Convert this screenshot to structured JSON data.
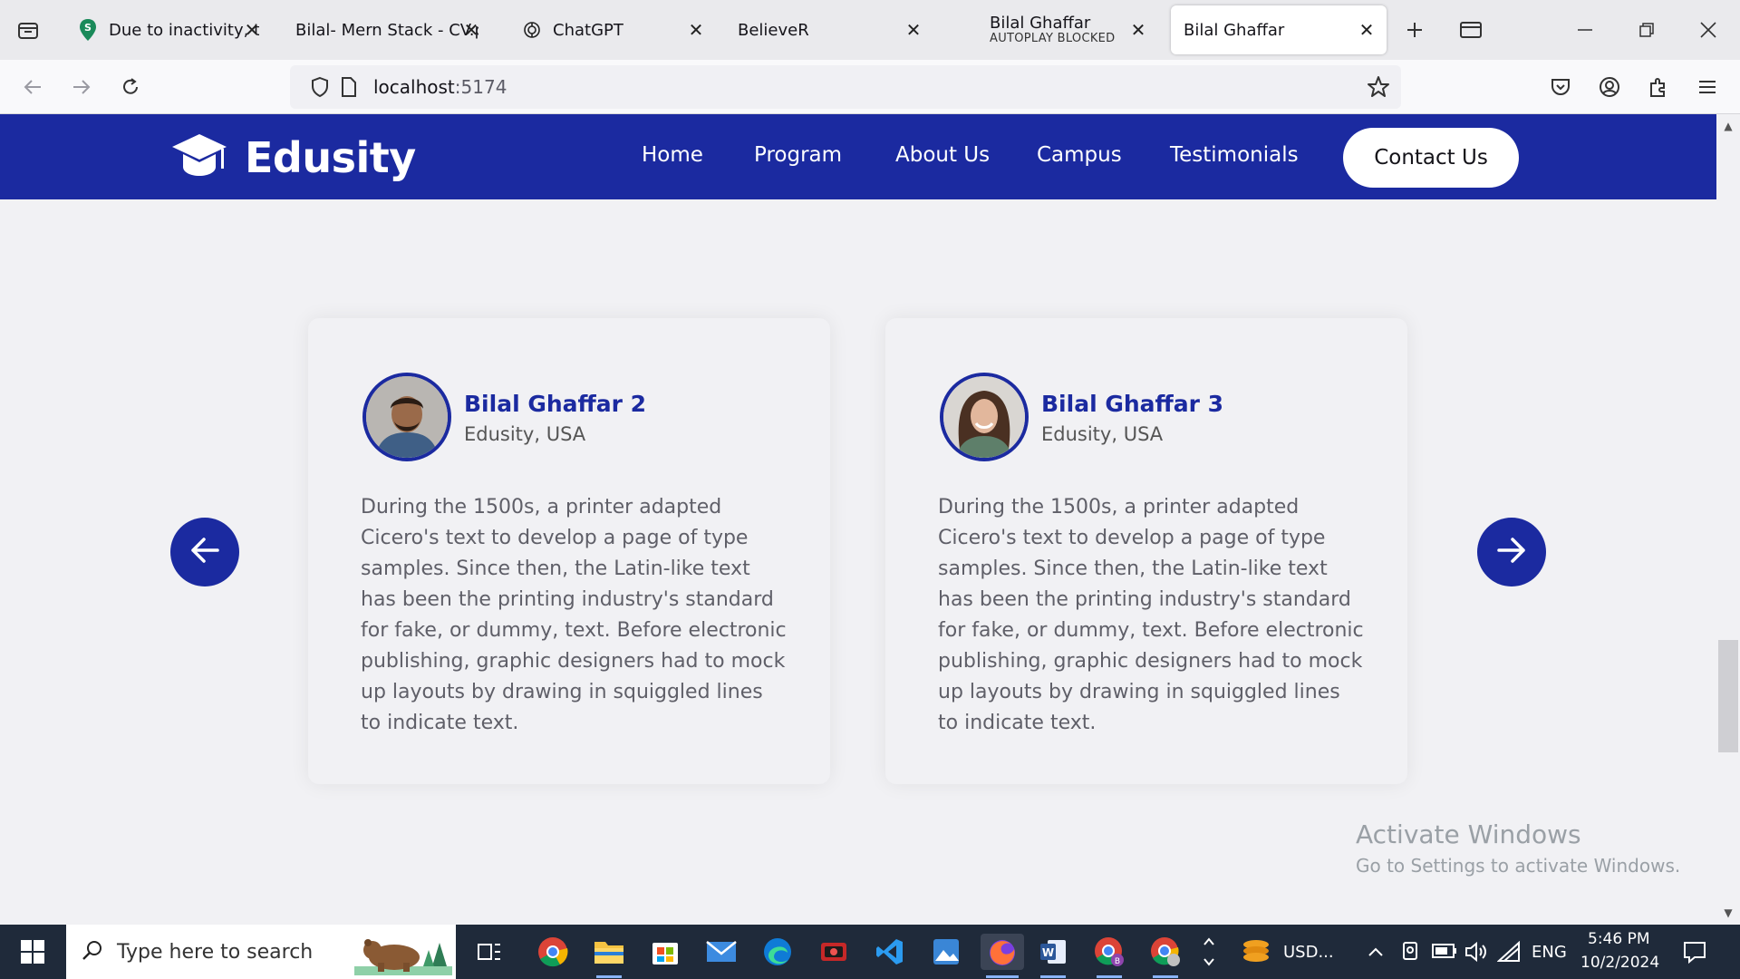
{
  "browser": {
    "tabs": [
      {
        "title": "Due to inactivity, the",
        "subtitle": "",
        "icon": "green-s-icon"
      },
      {
        "title": "Bilal- Mern Stack - CV.p",
        "subtitle": "",
        "icon": "none"
      },
      {
        "title": "ChatGPT",
        "subtitle": "",
        "icon": "chatgpt-icon"
      },
      {
        "title": "BelieveR",
        "subtitle": "",
        "icon": "none"
      },
      {
        "title": "Bilal Ghaffar",
        "subtitle": "AUTOPLAY BLOCKED",
        "icon": "none"
      },
      {
        "title": "Bilal Ghaffar",
        "subtitle": "",
        "icon": "none",
        "active": true
      }
    ],
    "url_host": "localhost",
    "url_port": ":5174"
  },
  "site": {
    "logo": "Edusity",
    "menu": [
      "Home",
      "Program",
      "About Us",
      "Campus",
      "Testimonials"
    ],
    "contact_label": "Contact Us",
    "brand_color": "#1b2aa0"
  },
  "testimonials": [
    {
      "name": "Bilal Ghaffar 2",
      "location": "Edusity, USA",
      "text": "During the 1500s, a printer adapted Cicero's text to develop a page of type samples. Since then, the Latin-like text has been the printing industry's standard for fake, or dummy, text. Before electronic publishing, graphic designers had to mock up layouts by drawing in squiggled lines to indicate text."
    },
    {
      "name": "Bilal Ghaffar 3",
      "location": "Edusity, USA",
      "text": "During the 1500s, a printer adapted Cicero's text to develop a page of type samples. Since then, the Latin-like text has been the printing industry's standard for fake, or dummy, text. Before electronic publishing, graphic designers had to mock up layouts by drawing in squiggled lines to indicate text."
    }
  ],
  "watermark": {
    "line1": "Activate Windows",
    "line2": "Go to Settings to activate Windows."
  },
  "taskbar": {
    "search_placeholder": "Type here to search",
    "widget_text": "USD...",
    "language": "ENG",
    "time": "5:46 PM",
    "date": "10/2/2024"
  }
}
